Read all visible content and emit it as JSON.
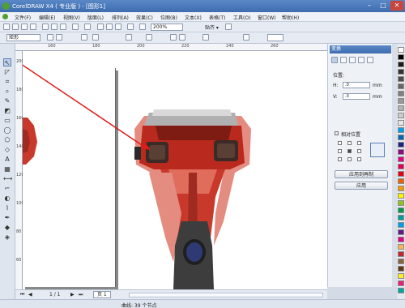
{
  "window": {
    "title": "CorelDRAW X4 ( 专业版 ) - [图形1]",
    "minimize_glyph": "–",
    "maximize_glyph": "□",
    "close_glyph": "✕"
  },
  "menu": [
    "文件(F)",
    "编辑(E)",
    "视图(V)",
    "版面(L)",
    "排列(A)",
    "效果(C)",
    "位图(B)",
    "文本(X)",
    "表格(T)",
    "工具(O)",
    "窗口(W)",
    "帮助(H)"
  ],
  "toolbar": {
    "zoom": "200%",
    "snap": "贴齐 ▾"
  },
  "property_bar": {
    "preset": "矩形"
  },
  "ruler": {
    "top_ticks": [
      "160",
      "180",
      "200",
      "220",
      "240",
      "260"
    ],
    "left_ticks": [
      "200",
      "180",
      "160",
      "140",
      "120",
      "100",
      "80",
      "60"
    ]
  },
  "docker": {
    "title": "变换",
    "position_label": "位置:",
    "x_label": "H:",
    "x_value": ".0",
    "y_label": "V:",
    "y_value": ".0",
    "unit": "mm",
    "relative_position": "相对位置",
    "apply_to_duplicate": "应用到再制",
    "apply": "应用"
  },
  "pager": {
    "page_count": "1 / 1",
    "page_tab": "页 1"
  },
  "status": {
    "object_info": "曲线: 39 个节点"
  },
  "palette_colors": [
    "#ffffff",
    "#000000",
    "#1a1a1a",
    "#333333",
    "#4d4d4d",
    "#666666",
    "#808080",
    "#999999",
    "#b3b3b3",
    "#cccccc",
    "#e6e6e6",
    "#00a0e9",
    "#0068b7",
    "#1d2088",
    "#920783",
    "#e4007f",
    "#e5004f",
    "#e60012",
    "#eb6100",
    "#f39800",
    "#fff100",
    "#8fc31f",
    "#009944",
    "#009e96",
    "#00a0e9",
    "#601986",
    "#e4007f",
    "#f8b551",
    "#c1272d",
    "#8c6239",
    "#603813",
    "#fcee21",
    "#ed1e79",
    "#00a99d"
  ]
}
